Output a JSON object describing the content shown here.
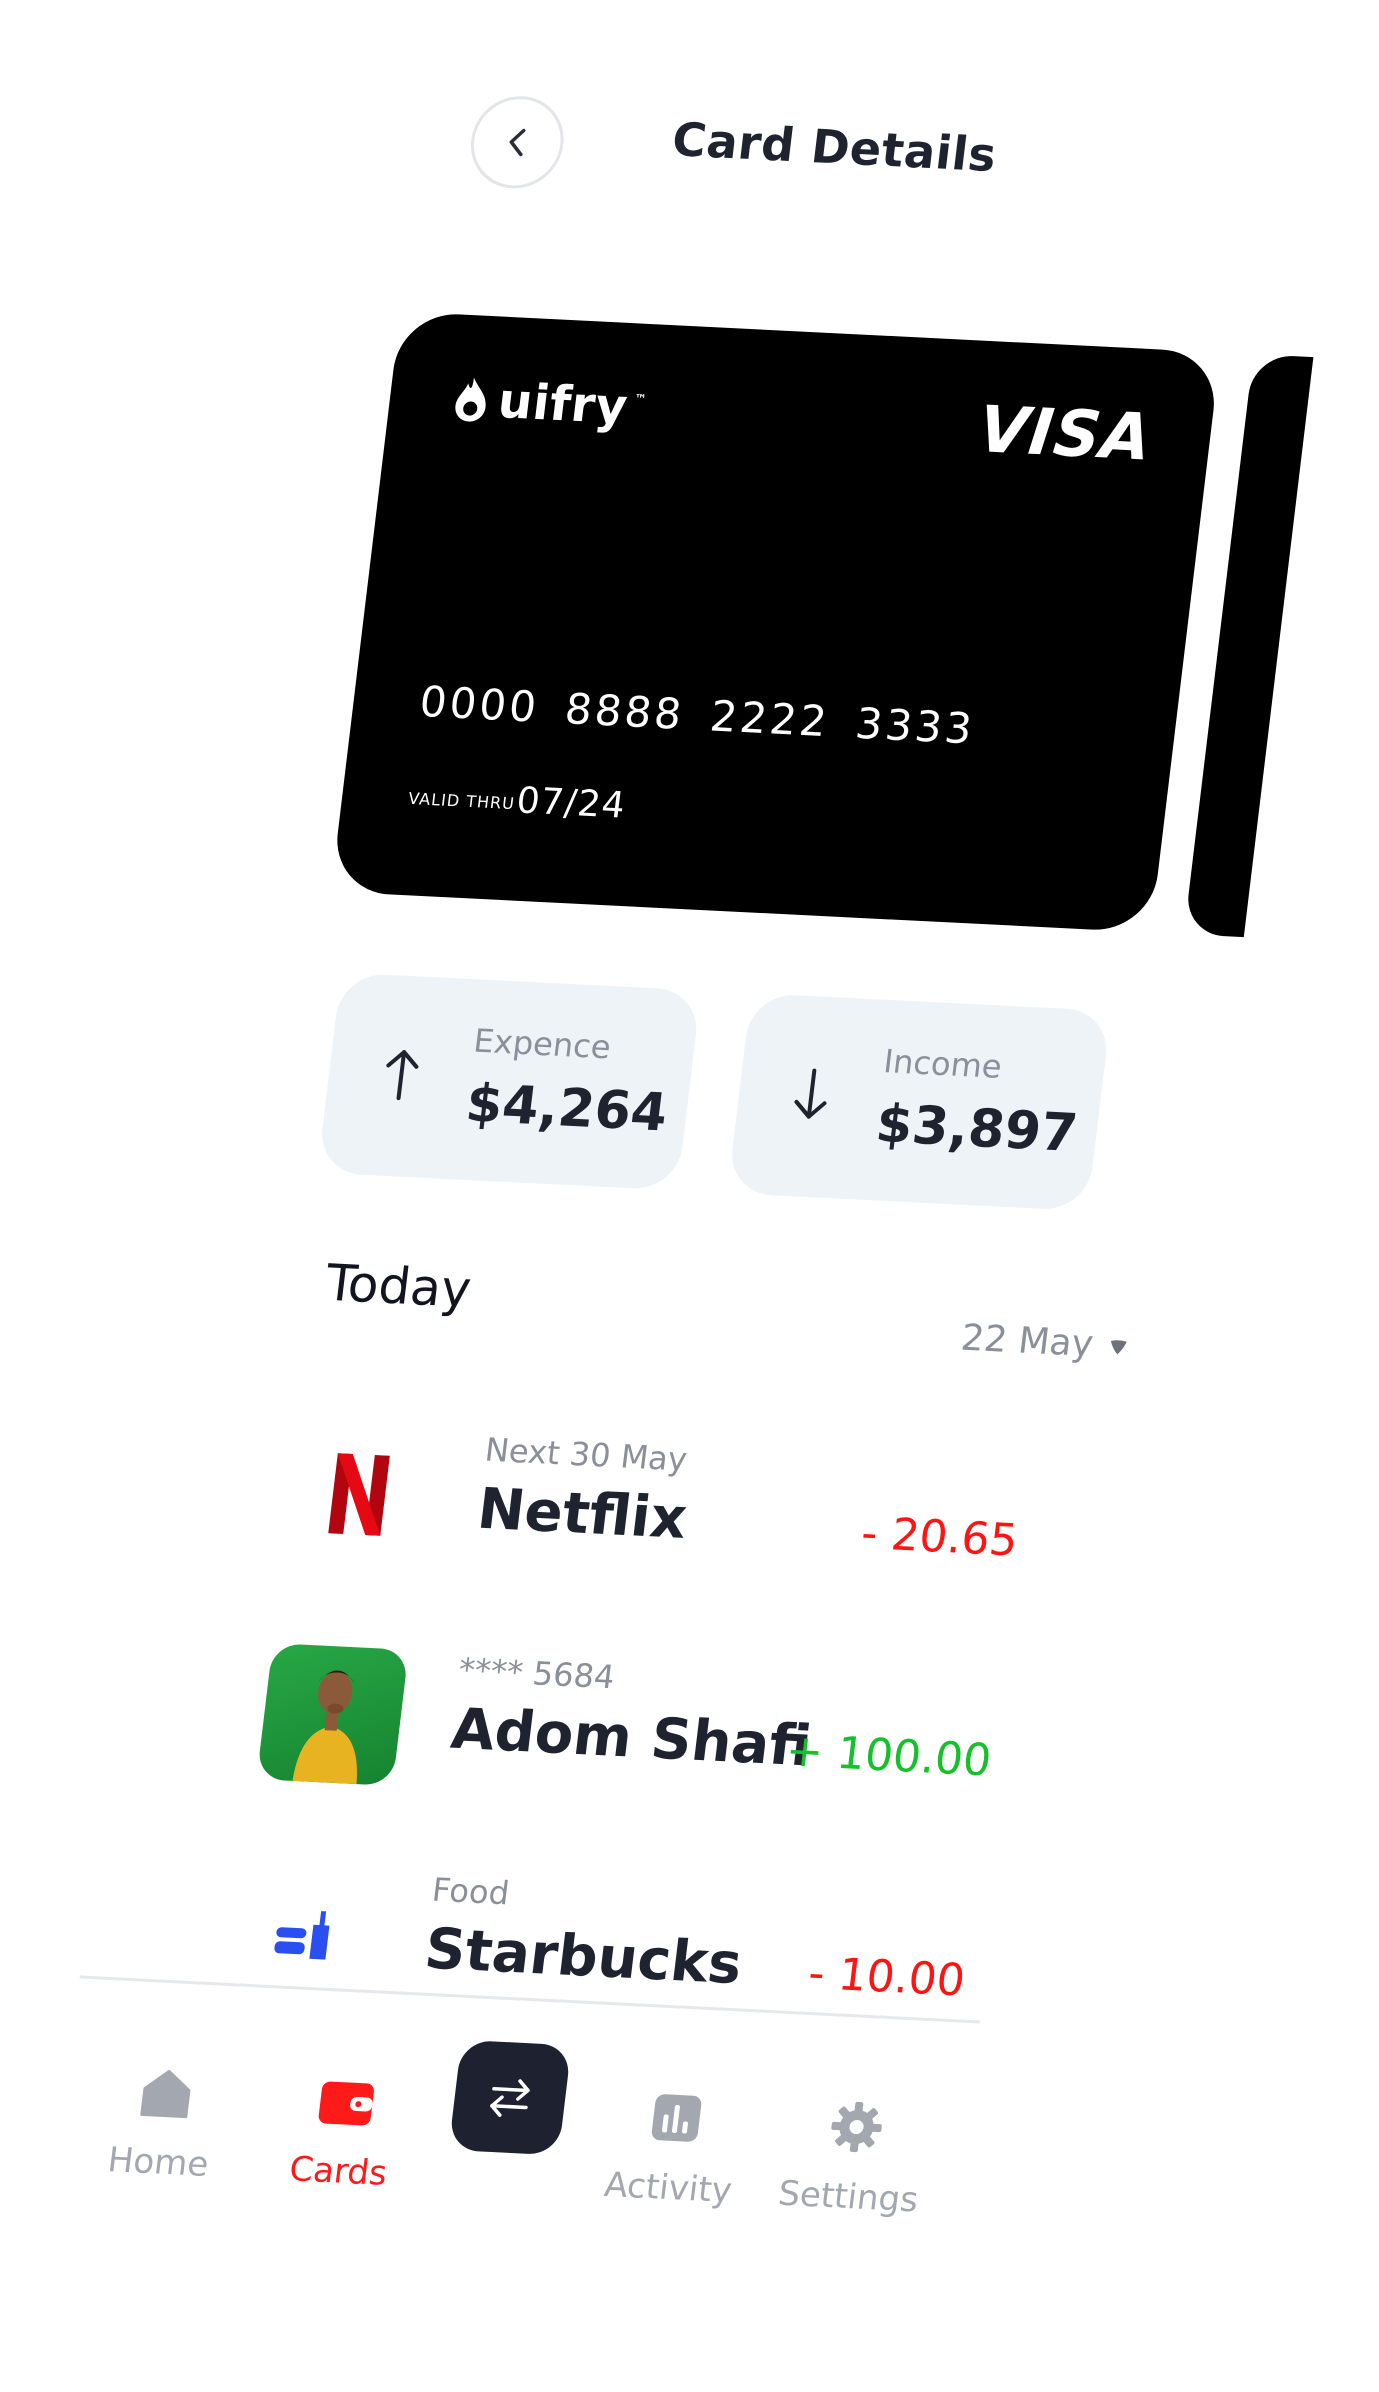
{
  "header": {
    "title": "Card Details"
  },
  "card": {
    "brand": "uifry",
    "brand_tm": "™",
    "network": "VISA",
    "number": "0000 8888 2222 3333",
    "valid_label": "VALID THRU",
    "valid_value": "07/24"
  },
  "summary": {
    "expense": {
      "label": "Expence",
      "value": "$4,264"
    },
    "income": {
      "label": "Income",
      "value": "$3,897"
    }
  },
  "transactions_header": {
    "title": "Today",
    "date_filter": "22 May"
  },
  "transactions": [
    {
      "logo": "netflix-logo",
      "sub": "Next 30 May",
      "name": "Netflix",
      "amount": "- 20.65",
      "type": "debit"
    },
    {
      "logo": "avatar",
      "sub": "**** 5684",
      "name": "Adom Shafi",
      "amount": "+ 100.00",
      "type": "credit"
    },
    {
      "logo": "starbucks-logo",
      "sub": "Food",
      "name": "Starbucks",
      "amount": "- 10.00",
      "type": "debit"
    }
  ],
  "nav": {
    "home": "Home",
    "cards": "Cards",
    "activity": "Activity",
    "settings": "Settings"
  },
  "colors": {
    "accent_red": "#ff1a1a",
    "credit_green": "#15c02a",
    "dark": "#1e2230",
    "summary_bg": "#eef3f7"
  }
}
